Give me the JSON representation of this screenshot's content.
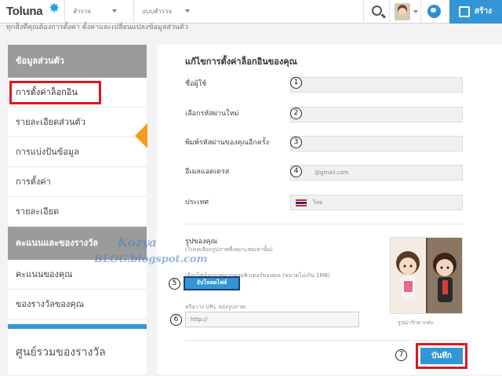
{
  "topbar": {
    "logo": "Toluna",
    "nav1": "สำรวจ",
    "nav2": "แบบสำรวจ",
    "create_label": "สร้าง"
  },
  "cut_text": "ทุกสิ่งที่คุณต้องการตั้งค่า ตั้งค่าและเปลี่ยนแปลงข้อมูลส่วนตัว",
  "sidebar": {
    "section1_title": "ข้อมูลส่วนตัว",
    "items": [
      {
        "label": "การตั้งค่าล็อกอิน"
      },
      {
        "label": "รายละเอียดส่วนตัว"
      },
      {
        "label": "การแบ่งปันข้อมูล"
      },
      {
        "label": "การตั้งค่า"
      },
      {
        "label": "รายละเอียด"
      }
    ],
    "section2_title": "คะแนนและของรางวัล",
    "items2": [
      {
        "label": "คะแนนของคุณ"
      },
      {
        "label": "ของรางวัลของคุณ"
      }
    ],
    "rewards_center": "ศูนย์รวมของรางวัล"
  },
  "main": {
    "title": "แก้ไขการตั้งค่าล็อกอินของคุณ",
    "fields": [
      {
        "label": "ชื่อผู้ใช้",
        "value": "",
        "num": "1"
      },
      {
        "label": "เลือกรหัสผ่านใหม่",
        "value": "",
        "num": "2"
      },
      {
        "label": "พิมพ์รหัสผ่านของคุณอีกครั้ง",
        "value": "",
        "num": "3"
      },
      {
        "label": "อีเมลแอดเดรส",
        "value": "@gmail.com",
        "num": "4"
      }
    ],
    "country_label": "ประเทศ",
    "country_value": "ไทย",
    "photo_title": "รูปของคุณ",
    "photo_sub": "(โปรดเลือกรูปภาพที่เหมาะสมเท่านั้น)",
    "photo_sub2": "เลือกไฟล์รูปภาพจากคอมพิวเตอร์ของคุณ (ขนาดไม่เกิน 1MB)",
    "upload_label": "อัปโหลดไฟล์",
    "num5": "5",
    "url_label": "หรือวาง URL ของรูปภาพ:",
    "url_value": "http://",
    "num6": "6",
    "photo_caption": "รูปน่ารักมากค่ะ",
    "save_label": "บันทึก",
    "num7": "7"
  },
  "watermark": {
    "line1": "Kozya",
    "line2": "BLOG.blogspot.com"
  },
  "colors": {
    "accent": "#3296d6",
    "highlight": "#e3151d",
    "active_arrow": "#f39c21",
    "sidebar_head": "#9b9b9b"
  }
}
